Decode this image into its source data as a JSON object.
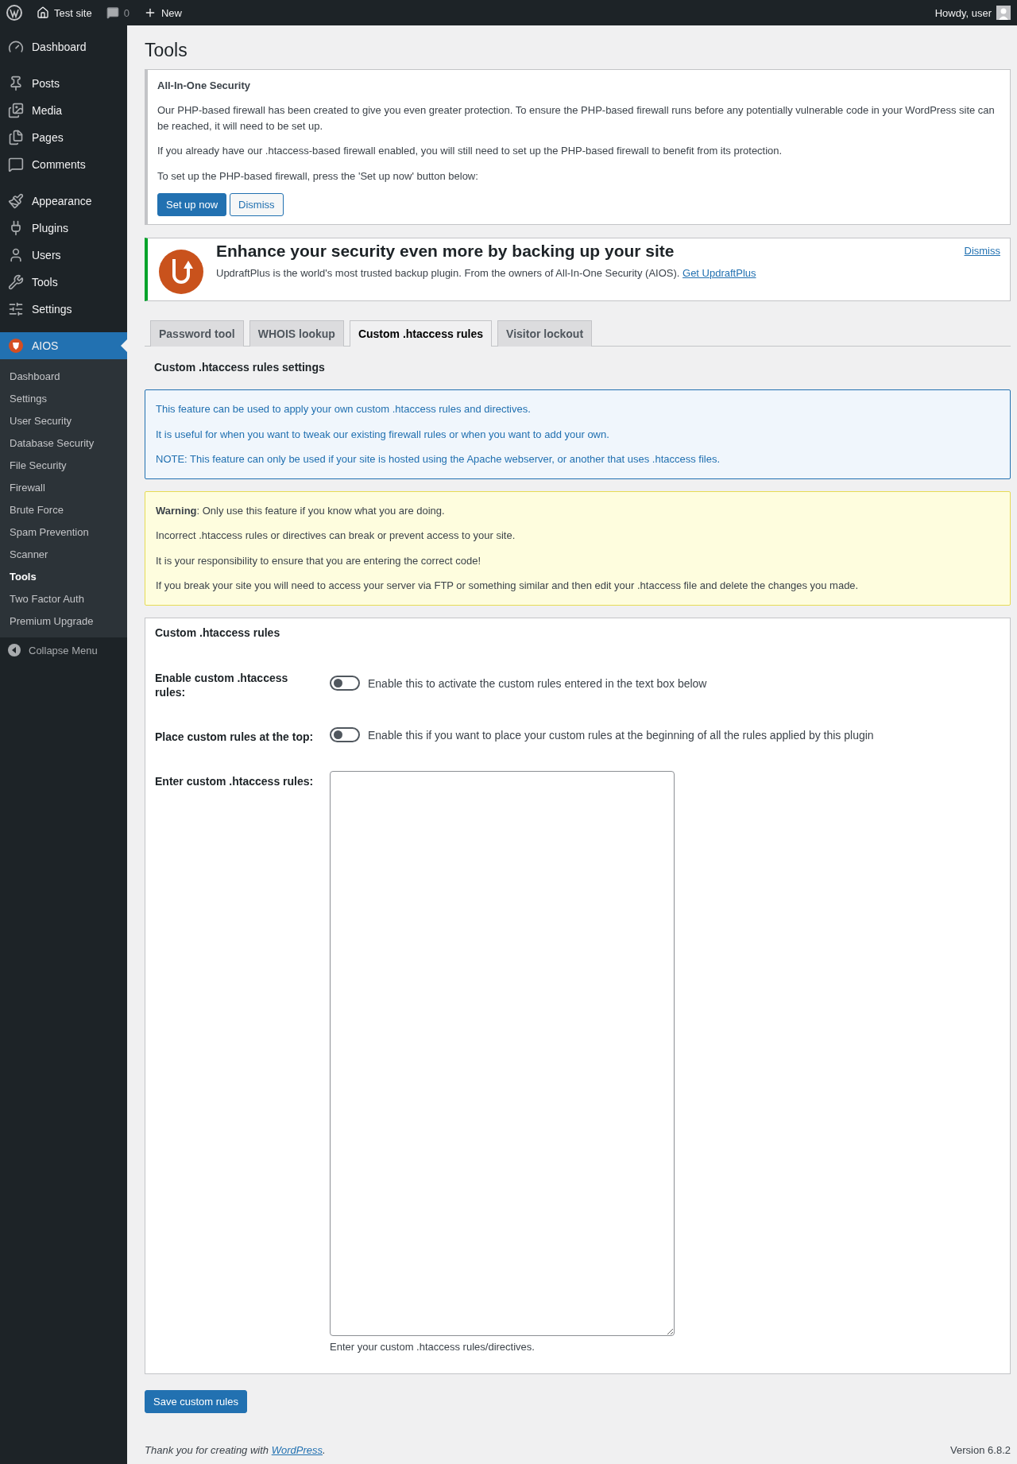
{
  "admin_bar": {
    "site": "Test site",
    "comments": "0",
    "new": "New",
    "greeting": "Howdy, user"
  },
  "sidebar": {
    "items": [
      {
        "label": "Dashboard",
        "selected": false
      },
      {
        "label": "Posts",
        "selected": false
      },
      {
        "label": "Media",
        "selected": false
      },
      {
        "label": "Pages",
        "selected": false
      },
      {
        "label": "Comments",
        "selected": false
      },
      {
        "label": "Appearance",
        "selected": false
      },
      {
        "label": "Plugins",
        "selected": false
      },
      {
        "label": "Users",
        "selected": false
      },
      {
        "label": "Tools",
        "selected": false
      },
      {
        "label": "Settings",
        "selected": false
      },
      {
        "label": "AIOS",
        "selected": true
      }
    ],
    "submenu": [
      {
        "label": "Dashboard",
        "selected": false
      },
      {
        "label": "Settings",
        "selected": false
      },
      {
        "label": "User Security",
        "selected": false
      },
      {
        "label": "Database Security",
        "selected": false
      },
      {
        "label": "File Security",
        "selected": false
      },
      {
        "label": "Firewall",
        "selected": false
      },
      {
        "label": "Brute Force",
        "selected": false
      },
      {
        "label": "Spam Prevention",
        "selected": false
      },
      {
        "label": "Scanner",
        "selected": false
      },
      {
        "label": "Tools",
        "selected": true
      },
      {
        "label": "Two Factor Auth",
        "selected": false
      },
      {
        "label": "Premium Upgrade",
        "selected": false
      }
    ],
    "collapse": "Collapse Menu"
  },
  "page_title": "Tools",
  "firewall_notice": {
    "title": "All-In-One Security",
    "paragraphs": [
      "Our PHP-based firewall has been created to give you even greater protection. To ensure the PHP-based firewall runs before any potentially vulnerable code in your WordPress site can be reached, it will need to be set up.",
      "If you already have our .htaccess-based firewall enabled, you will still need to set up the PHP-based firewall to benefit from its protection.",
      "To set up the PHP-based firewall, press the 'Set up now' button below:"
    ],
    "primary_button": "Set up now",
    "secondary_button": "Dismiss"
  },
  "updraft_notice": {
    "heading": "Enhance your security even more by backing up your site",
    "text": "UpdraftPlus is the world's most trusted backup plugin. From the owners of All-In-One Security (AIOS).",
    "link": "Get UpdraftPlus",
    "dismiss": "Dismiss"
  },
  "tabs": [
    {
      "label": "Password tool",
      "selected": false
    },
    {
      "label": "WHOIS lookup",
      "selected": false
    },
    {
      "label": "Custom .htaccess rules",
      "selected": true
    },
    {
      "label": "Visitor lockout",
      "selected": false
    }
  ],
  "section_heading": "Custom .htaccess rules settings",
  "info_box": [
    "This feature can be used to apply your own custom .htaccess rules and directives.",
    "It is useful for when you want to tweak our existing firewall rules or when you want to add your own.",
    "NOTE: This feature can only be used if your site is hosted using the Apache webserver, or another that uses .htaccess files."
  ],
  "warning_box": [
    "**Warning**: Only use this feature if you know what you are doing.",
    "Incorrect .htaccess rules or directives can break or prevent access to your site.",
    "It is your responsibility to ensure that you are entering the correct code!",
    "If you break your site you will need to access your server via FTP or something similar and then edit your .htaccess file and delete the changes you made."
  ],
  "rules_panel": {
    "title": "Custom .htaccess rules",
    "rows": [
      {
        "kind": "toggle",
        "label": "Enable custom .htaccess rules:",
        "on": false,
        "description": "Enable this to activate the custom rules entered in the text box below"
      },
      {
        "kind": "toggle",
        "label": "Place custom rules at the top:",
        "on": false,
        "description": "Enable this if you want to place your custom rules at the beginning of all the rules applied by this plugin"
      },
      {
        "kind": "textarea",
        "label": "Enter custom .htaccess rules:",
        "description": "Enter your custom .htaccess rules/directives."
      }
    ]
  },
  "save_button": "Save custom rules",
  "footer": {
    "text": "Thank you for creating with",
    "link": "WordPress",
    "end": ".",
    "version": "Version 6.8.2"
  }
}
